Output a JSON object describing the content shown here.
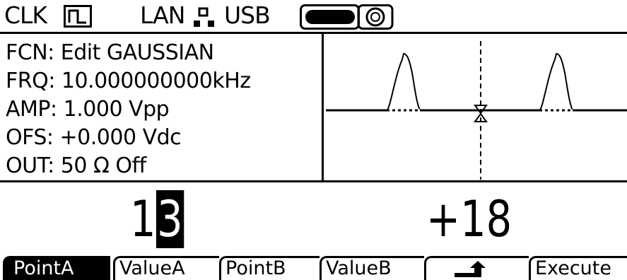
{
  "status": {
    "clk_label": "CLK",
    "lan_label": "LAN",
    "usb_label": "USB"
  },
  "info": {
    "lines": [
      "FCN: Edit GAUSSIAN",
      "FRQ: 10.000000000kHz",
      "AMP: 1.000 Vpp",
      "OFS: +0.000 Vdc",
      "OUT: 50 Ω Off"
    ]
  },
  "edit": {
    "point_prefix": "1",
    "point_cursor_digit": "3",
    "value": "+18"
  },
  "softkeys": [
    {
      "label": "PointA"
    },
    {
      "label": "ValueA"
    },
    {
      "label": "PointB"
    },
    {
      "label": "ValueB"
    },
    {
      "icon": "return-arrow-icon"
    },
    {
      "label": "Execute"
    }
  ]
}
